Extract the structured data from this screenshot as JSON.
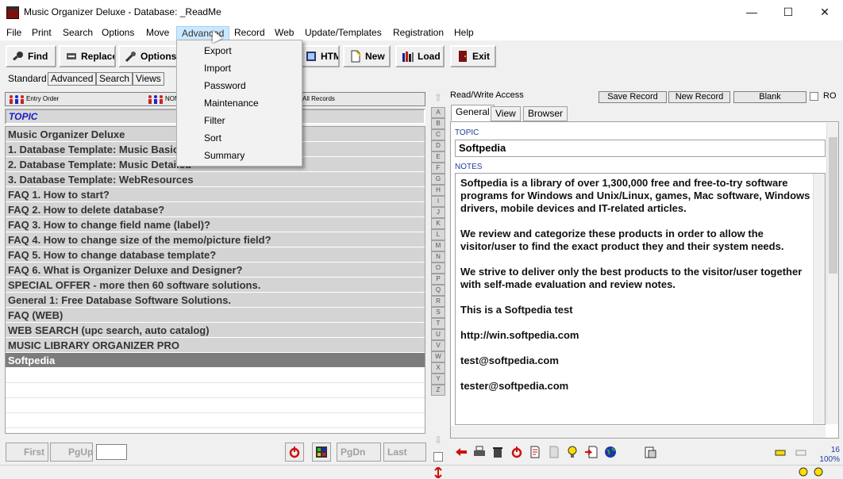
{
  "window": {
    "title": "Music Organizer Deluxe - Database: _ReadMe",
    "minimize": "—",
    "maximize": "☐",
    "close": "✕"
  },
  "menubar": [
    "File",
    "Print",
    "Search",
    "Options",
    "Move",
    "Advanced",
    "Record",
    "Web",
    "Update/Templates",
    "Registration",
    "Help"
  ],
  "toolbar": {
    "find": "Find",
    "replace": "Replace",
    "options": "Options",
    "html": "HTML",
    "new": "New",
    "load": "Load",
    "exit": "Exit"
  },
  "advanced_menu": [
    "Export",
    "Import",
    "Password",
    "Maintenance",
    "Filter",
    "Sort",
    "Summary"
  ],
  "left_tabs": [
    "Standard",
    "Advanced",
    "Search",
    "Views"
  ],
  "left_header": {
    "entry_order": "Entry Order",
    "nom": "NOM",
    "all_records": "All Records"
  },
  "topic_header": "TOPIC",
  "records": [
    "Music Organizer Deluxe",
    "1. Database Template: Music Basic",
    "2. Database Template: Music Detailed",
    "3. Database Template: WebResources",
    "FAQ 1. How to start?",
    "FAQ 2. How to delete database?",
    "FAQ 3. How to change field name (label)?",
    "FAQ 4. How to change size of the memo/picture field?",
    "FAQ 5. How to change database template?",
    "FAQ 6. What is Organizer Deluxe and Designer?",
    "SPECIAL OFFER - more then 60 software solutions.",
    "General 1: Free Database Software Solutions.",
    "FAQ (WEB)",
    "WEB SEARCH (upc search, auto catalog)",
    "MUSIC LIBRARY ORGANIZER PRO",
    "Softpedia"
  ],
  "alphabet": [
    "A",
    "B",
    "C",
    "D",
    "E",
    "F",
    "G",
    "H",
    "I",
    "J",
    "K",
    "L",
    "M",
    "N",
    "O",
    "P",
    "Q",
    "R",
    "S",
    "T",
    "U",
    "V",
    "W",
    "X",
    "Y",
    "Z"
  ],
  "right": {
    "access": "Read/Write Access",
    "save": "Save Record",
    "new": "New Record",
    "blank": "Blank",
    "ro": "RO",
    "tabs": [
      "General",
      "View",
      "Browser"
    ],
    "topic_label": "TOPIC",
    "topic_value": "Softpedia",
    "notes_label": "NOTES",
    "notes": [
      "Softpedia is a library of over 1,300,000 free and free-to-try software programs for Windows and Unix/Linux, games, Mac software, Windows drivers, mobile devices and IT-related articles.",
      "We review and categorize these products in order to allow the visitor/user to find the exact product they and their system needs.",
      "We strive to deliver only the best products to the visitor/user together with self-made evaluation and review notes.",
      "This is a Softpedia test",
      "http://win.softpedia.com",
      "test@softpedia.com",
      "tester@softpedia.com"
    ]
  },
  "bottom": {
    "first": "First",
    "pgup": "PgUp",
    "pgdn": "PgDn",
    "last": "Last",
    "count": "16",
    "zoom": "100%"
  },
  "colors": {
    "accent": "#1b1bcc",
    "selected_row": "#7c7c7c",
    "row": "#d4d4d4",
    "menu_hover": "#cce8ff"
  }
}
